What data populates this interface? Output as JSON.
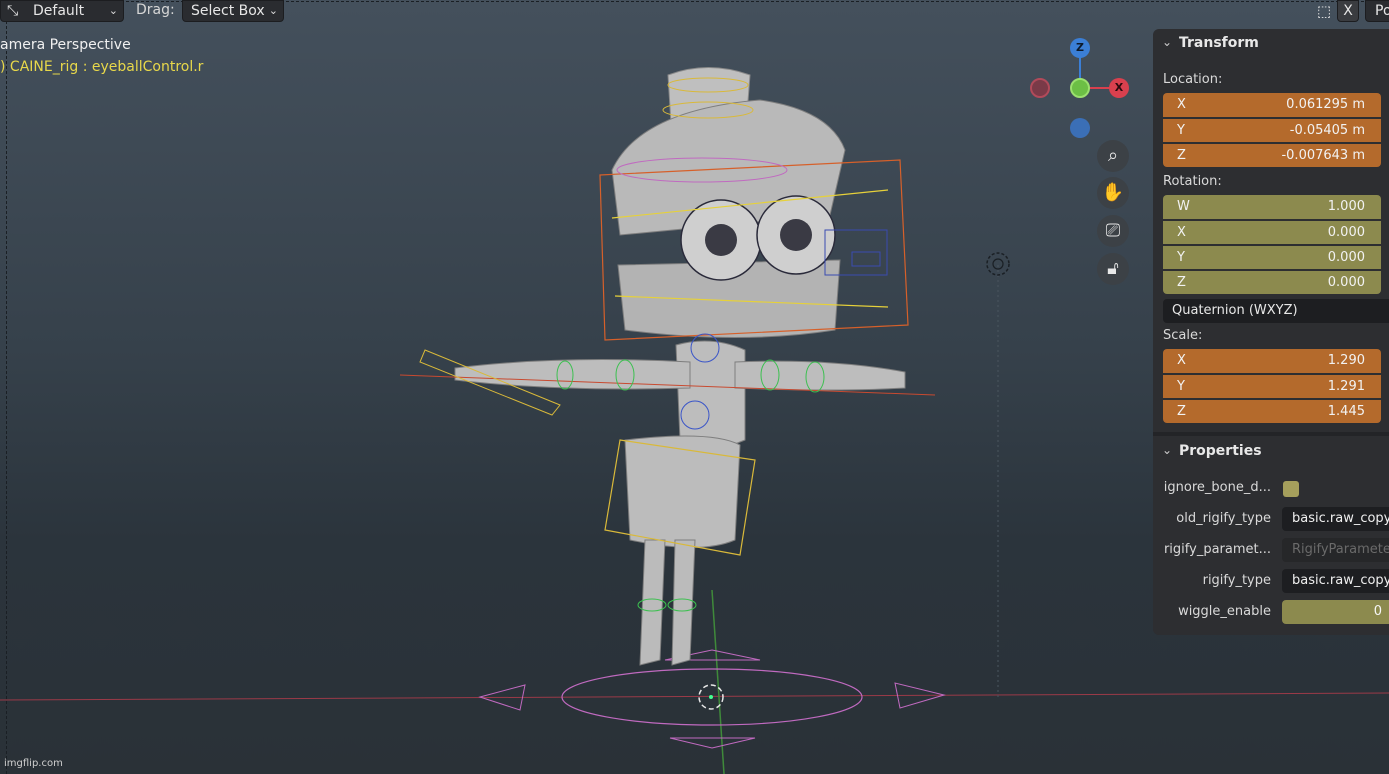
{
  "header": {
    "view_icon": "view-transform-icon",
    "mode_value": "Default",
    "drag_label": "Drag:",
    "select_value": "Select Box",
    "close_label": "X",
    "tab_right": "Po"
  },
  "viewport": {
    "camera_label": "amera Perspective",
    "object_label": ") CAINE_rig : eyeballControl.r",
    "gizmo": {
      "z": "Z",
      "x": "X"
    }
  },
  "transform": {
    "title": "Transform",
    "location_label": "Location:",
    "location": [
      {
        "axis": "X",
        "value": "0.061295 m"
      },
      {
        "axis": "Y",
        "value": "-0.05405 m"
      },
      {
        "axis": "Z",
        "value": "-0.007643 m"
      }
    ],
    "rotation_label": "Rotation:",
    "rotation": [
      {
        "axis": "W",
        "value": "1.000"
      },
      {
        "axis": "X",
        "value": "0.000"
      },
      {
        "axis": "Y",
        "value": "0.000"
      },
      {
        "axis": "Z",
        "value": "0.000"
      }
    ],
    "rotation_mode": "Quaternion (WXYZ)",
    "scale_label": "Scale:",
    "scale": [
      {
        "axis": "X",
        "value": "1.290"
      },
      {
        "axis": "Y",
        "value": "1.291"
      },
      {
        "axis": "Z",
        "value": "1.445"
      }
    ]
  },
  "properties": {
    "title": "Properties",
    "items": [
      {
        "label": "ignore_bone_d...",
        "type": "checkbox"
      },
      {
        "label": "old_rigify_type",
        "value": "basic.raw_copy"
      },
      {
        "label": "rigify_paramet...",
        "value": "RigifyParameters"
      },
      {
        "label": "rigify_type",
        "value": "basic.raw_copy"
      },
      {
        "label": "wiggle_enable",
        "value": "0"
      }
    ]
  },
  "watermark": "imgflip.com",
  "colors": {
    "accent_orange": "#b46a2c",
    "accent_olive": "#8c8a4e",
    "panel_bg": "#2d2e31"
  }
}
